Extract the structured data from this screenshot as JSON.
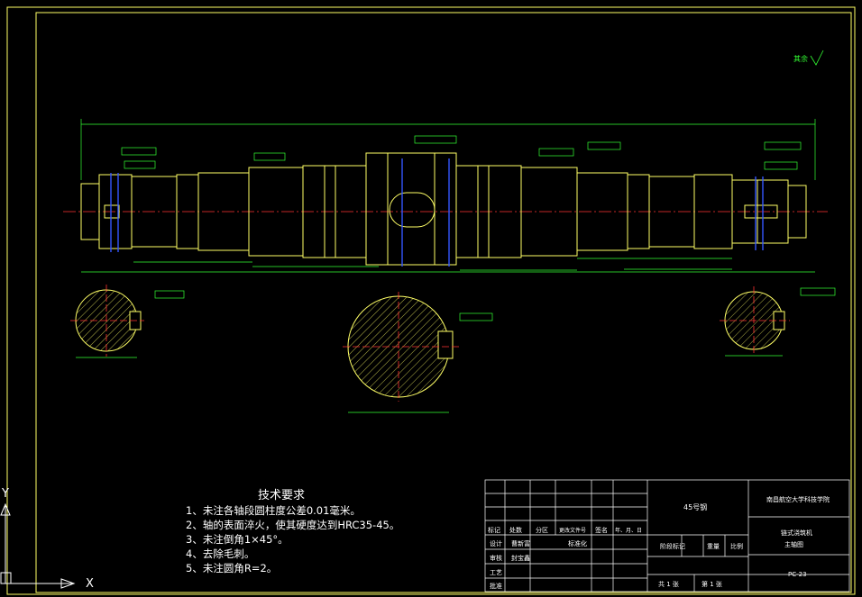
{
  "drawing": {
    "roughness_note": "其余",
    "tech_requirements": {
      "title": "技术要求",
      "items": [
        "1、未注各轴段圆柱度公差0.01毫米。",
        "2、轴的表面淬火，使其硬度达到HRC35-45。",
        "3、未注倒角1×45°。",
        "4、去除毛刺。",
        "5、未注圆角R=2。"
      ]
    },
    "title_block": {
      "material": "45号钢",
      "school": "南昌航空大学科技学院",
      "part_name_line1": "链式浇筑机",
      "part_name_line2": "主轴图",
      "drawing_number": "PC-23",
      "headers": [
        "标记",
        "处数",
        "分区",
        "更改文件号",
        "签名",
        "年、月、日"
      ],
      "row_design": "设计",
      "row_check": "审核",
      "row_process": "工艺",
      "row_approve": "批准",
      "designer": "曹新富",
      "checker": "封宝鑫",
      "standardize": "标准化",
      "stage_mark": "阶段标记",
      "weight": "重量",
      "scale": "比例",
      "sheets_total": "共 1 张",
      "sheet_no": "第 1 张"
    },
    "ucs": {
      "x": "X",
      "y": "Y"
    }
  },
  "colors": {
    "outline": "#ffff66",
    "dim": "#33ff33",
    "center": "#ff3333",
    "hatch": "#ffff66",
    "keyway": "#3355ff",
    "text": "#ffffff"
  }
}
